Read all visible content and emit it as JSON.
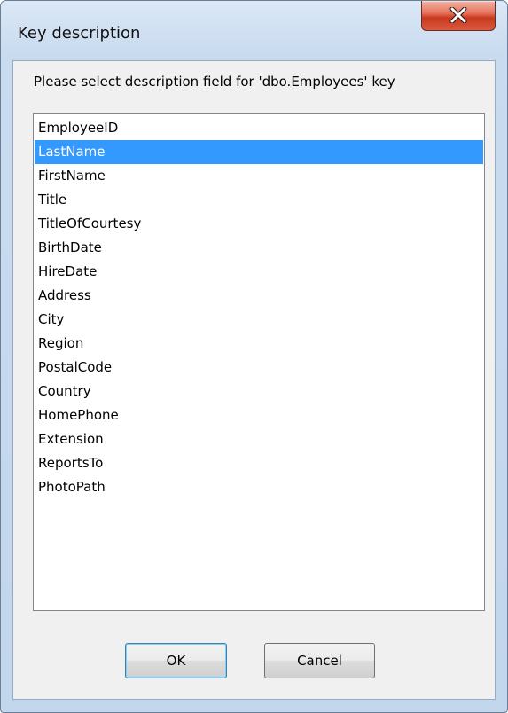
{
  "window": {
    "title": "Key description",
    "close_icon": "close-x-icon"
  },
  "prompt": "Please select description field for 'dbo.Employees' key",
  "list": {
    "selected": "LastName",
    "items": [
      "EmployeeID",
      "LastName",
      "FirstName",
      "Title",
      "TitleOfCourtesy",
      "BirthDate",
      "HireDate",
      "Address",
      "City",
      "Region",
      "PostalCode",
      "Country",
      "HomePhone",
      "Extension",
      "ReportsTo",
      "PhotoPath"
    ]
  },
  "buttons": {
    "ok": "OK",
    "cancel": "Cancel"
  },
  "colors": {
    "selection": "#3399ff",
    "close_button": "#c8391f"
  }
}
